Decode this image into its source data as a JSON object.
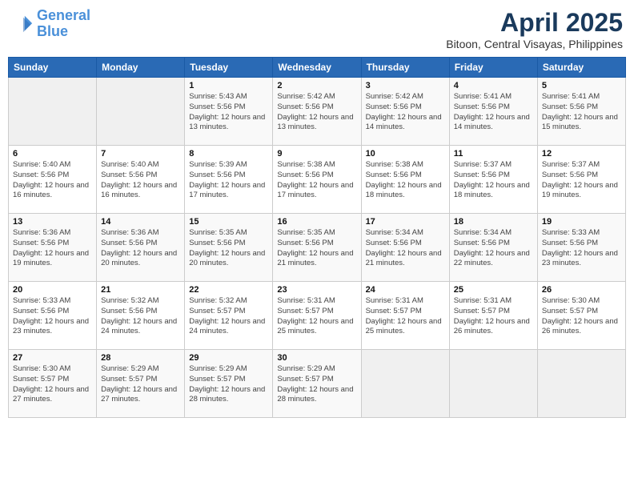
{
  "header": {
    "logo_line1": "General",
    "logo_line2": "Blue",
    "title": "April 2025",
    "subtitle": "Bitoon, Central Visayas, Philippines"
  },
  "weekdays": [
    "Sunday",
    "Monday",
    "Tuesday",
    "Wednesday",
    "Thursday",
    "Friday",
    "Saturday"
  ],
  "weeks": [
    [
      {
        "day": "",
        "info": ""
      },
      {
        "day": "",
        "info": ""
      },
      {
        "day": "1",
        "info": "Sunrise: 5:43 AM\nSunset: 5:56 PM\nDaylight: 12 hours and 13 minutes."
      },
      {
        "day": "2",
        "info": "Sunrise: 5:42 AM\nSunset: 5:56 PM\nDaylight: 12 hours and 13 minutes."
      },
      {
        "day": "3",
        "info": "Sunrise: 5:42 AM\nSunset: 5:56 PM\nDaylight: 12 hours and 14 minutes."
      },
      {
        "day": "4",
        "info": "Sunrise: 5:41 AM\nSunset: 5:56 PM\nDaylight: 12 hours and 14 minutes."
      },
      {
        "day": "5",
        "info": "Sunrise: 5:41 AM\nSunset: 5:56 PM\nDaylight: 12 hours and 15 minutes."
      }
    ],
    [
      {
        "day": "6",
        "info": "Sunrise: 5:40 AM\nSunset: 5:56 PM\nDaylight: 12 hours and 16 minutes."
      },
      {
        "day": "7",
        "info": "Sunrise: 5:40 AM\nSunset: 5:56 PM\nDaylight: 12 hours and 16 minutes."
      },
      {
        "day": "8",
        "info": "Sunrise: 5:39 AM\nSunset: 5:56 PM\nDaylight: 12 hours and 17 minutes."
      },
      {
        "day": "9",
        "info": "Sunrise: 5:38 AM\nSunset: 5:56 PM\nDaylight: 12 hours and 17 minutes."
      },
      {
        "day": "10",
        "info": "Sunrise: 5:38 AM\nSunset: 5:56 PM\nDaylight: 12 hours and 18 minutes."
      },
      {
        "day": "11",
        "info": "Sunrise: 5:37 AM\nSunset: 5:56 PM\nDaylight: 12 hours and 18 minutes."
      },
      {
        "day": "12",
        "info": "Sunrise: 5:37 AM\nSunset: 5:56 PM\nDaylight: 12 hours and 19 minutes."
      }
    ],
    [
      {
        "day": "13",
        "info": "Sunrise: 5:36 AM\nSunset: 5:56 PM\nDaylight: 12 hours and 19 minutes."
      },
      {
        "day": "14",
        "info": "Sunrise: 5:36 AM\nSunset: 5:56 PM\nDaylight: 12 hours and 20 minutes."
      },
      {
        "day": "15",
        "info": "Sunrise: 5:35 AM\nSunset: 5:56 PM\nDaylight: 12 hours and 20 minutes."
      },
      {
        "day": "16",
        "info": "Sunrise: 5:35 AM\nSunset: 5:56 PM\nDaylight: 12 hours and 21 minutes."
      },
      {
        "day": "17",
        "info": "Sunrise: 5:34 AM\nSunset: 5:56 PM\nDaylight: 12 hours and 21 minutes."
      },
      {
        "day": "18",
        "info": "Sunrise: 5:34 AM\nSunset: 5:56 PM\nDaylight: 12 hours and 22 minutes."
      },
      {
        "day": "19",
        "info": "Sunrise: 5:33 AM\nSunset: 5:56 PM\nDaylight: 12 hours and 23 minutes."
      }
    ],
    [
      {
        "day": "20",
        "info": "Sunrise: 5:33 AM\nSunset: 5:56 PM\nDaylight: 12 hours and 23 minutes."
      },
      {
        "day": "21",
        "info": "Sunrise: 5:32 AM\nSunset: 5:56 PM\nDaylight: 12 hours and 24 minutes."
      },
      {
        "day": "22",
        "info": "Sunrise: 5:32 AM\nSunset: 5:57 PM\nDaylight: 12 hours and 24 minutes."
      },
      {
        "day": "23",
        "info": "Sunrise: 5:31 AM\nSunset: 5:57 PM\nDaylight: 12 hours and 25 minutes."
      },
      {
        "day": "24",
        "info": "Sunrise: 5:31 AM\nSunset: 5:57 PM\nDaylight: 12 hours and 25 minutes."
      },
      {
        "day": "25",
        "info": "Sunrise: 5:31 AM\nSunset: 5:57 PM\nDaylight: 12 hours and 26 minutes."
      },
      {
        "day": "26",
        "info": "Sunrise: 5:30 AM\nSunset: 5:57 PM\nDaylight: 12 hours and 26 minutes."
      }
    ],
    [
      {
        "day": "27",
        "info": "Sunrise: 5:30 AM\nSunset: 5:57 PM\nDaylight: 12 hours and 27 minutes."
      },
      {
        "day": "28",
        "info": "Sunrise: 5:29 AM\nSunset: 5:57 PM\nDaylight: 12 hours and 27 minutes."
      },
      {
        "day": "29",
        "info": "Sunrise: 5:29 AM\nSunset: 5:57 PM\nDaylight: 12 hours and 28 minutes."
      },
      {
        "day": "30",
        "info": "Sunrise: 5:29 AM\nSunset: 5:57 PM\nDaylight: 12 hours and 28 minutes."
      },
      {
        "day": "",
        "info": ""
      },
      {
        "day": "",
        "info": ""
      },
      {
        "day": "",
        "info": ""
      }
    ]
  ]
}
